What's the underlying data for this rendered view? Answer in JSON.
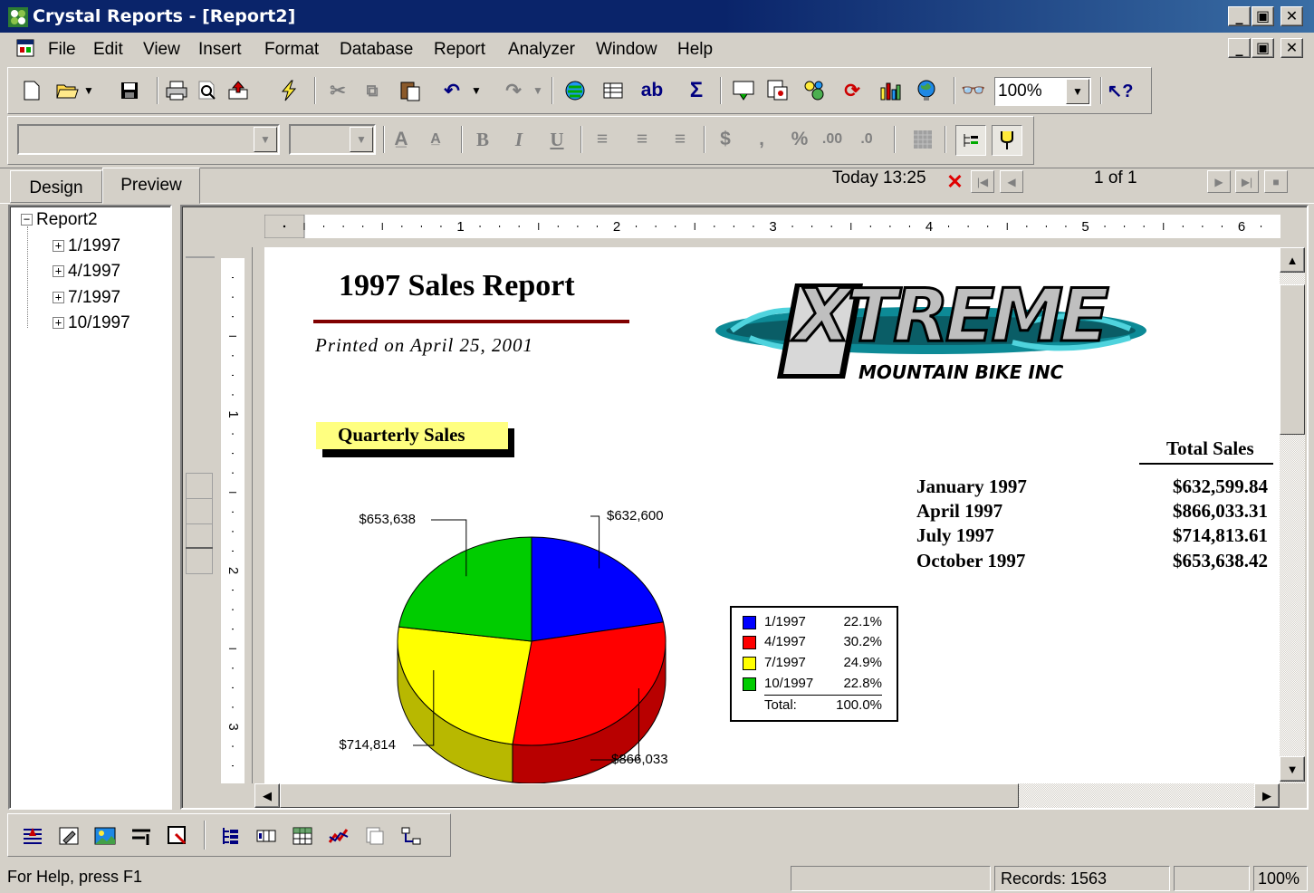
{
  "window": {
    "title": "Crystal Reports - [Report2]"
  },
  "menu": [
    "File",
    "Edit",
    "View",
    "Insert",
    "Format",
    "Database",
    "Report",
    "Analyzer",
    "Window",
    "Help"
  ],
  "toolbar": {
    "zoom_value": "100%",
    "ab_label": "ab",
    "sigma_label": "Σ"
  },
  "tabs": {
    "design": "Design",
    "preview": "Preview"
  },
  "nav": {
    "timestamp": "Today 13:25",
    "page_indicator": "1 of 1"
  },
  "tree": {
    "root": "Report2",
    "groups": [
      "1/1997",
      "4/1997",
      "7/1997",
      "10/1997"
    ]
  },
  "ruler": {
    "h_numbers": [
      "1",
      "2",
      "3",
      "4",
      "5",
      "6"
    ],
    "v_numbers": [
      "1",
      "2",
      "3"
    ]
  },
  "report": {
    "title": "1997 Sales Report",
    "printed_on": "Printed on April 25, 2001",
    "logo_text": "XTREME",
    "logo_sub": "MOUNTAIN BIKE INC",
    "section_label": "Quarterly Sales",
    "total_header": "Total Sales",
    "rows": [
      {
        "label": "January 1997",
        "value": "$632,599.84"
      },
      {
        "label": "April 1997",
        "value": "$866,033.31"
      },
      {
        "label": "July 1997",
        "value": "$714,813.61"
      },
      {
        "label": "October 1997",
        "value": "$653,638.42"
      }
    ]
  },
  "chart_data": {
    "type": "pie",
    "categories": [
      "1/1997",
      "4/1997",
      "7/1997",
      "10/1997"
    ],
    "values": [
      632600,
      866033,
      714814,
      653638
    ],
    "data_labels": [
      "$632,600",
      "$866,033",
      "$714,814",
      "$653,638"
    ],
    "percentages": [
      "22.1%",
      "30.2%",
      "24.9%",
      "22.8%"
    ],
    "colors": [
      "#0000ff",
      "#ff0000",
      "#ffff00",
      "#00cc00"
    ],
    "total_label": "Total:",
    "total_percent": "100.0%",
    "legend_position": "right",
    "three_d": true
  },
  "status": {
    "help": "For Help, press F1",
    "records": "Records:  1563",
    "zoom": "100%"
  }
}
